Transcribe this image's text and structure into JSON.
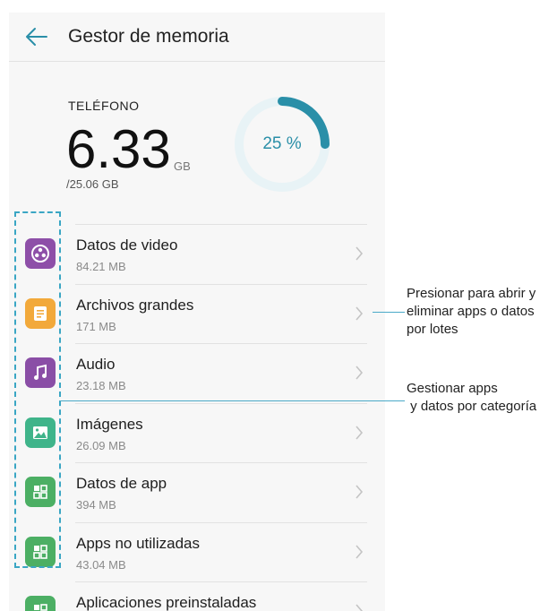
{
  "header": {
    "title": "Gestor de memoria"
  },
  "storage": {
    "label": "TELÉFONO",
    "used": "6.33",
    "unit": "GB",
    "total": "/25.06 GB",
    "percent_label": "25 %",
    "percent": 25
  },
  "categories": [
    {
      "name": "Datos de video",
      "size": "84.21 MB",
      "icon": "video-reel-icon",
      "color": "#8e4fa8"
    },
    {
      "name": "Archivos grandes",
      "size": "171 MB",
      "icon": "document-icon",
      "color": "#f2a93b"
    },
    {
      "name": "Audio",
      "size": "23.18 MB",
      "icon": "music-note-icon",
      "color": "#8a4ea6"
    },
    {
      "name": "Imágenes",
      "size": "26.09 MB",
      "icon": "image-icon",
      "color": "#3fb48a"
    },
    {
      "name": "Datos de app",
      "size": "394 MB",
      "icon": "apps-grid-icon",
      "color": "#4caf64"
    },
    {
      "name": "Apps no utilizadas",
      "size": "43.04 MB",
      "icon": "apps-grid-icon",
      "color": "#4caf64"
    },
    {
      "name": "Aplicaciones preinstaladas",
      "size": "",
      "icon": "apps-grid-icon",
      "color": "#4caf64"
    }
  ],
  "callouts": {
    "open": [
      "Presionar para abrir y",
      "eliminar apps o datos",
      "por lotes"
    ],
    "category": [
      "Gestionar apps",
      " y datos por categoría"
    ]
  },
  "colors": {
    "accent": "#2a8fa8",
    "ring_track": "#e8f3f6",
    "ring_fill": "#2a8fa8",
    "callout": "#4aa9c8"
  }
}
